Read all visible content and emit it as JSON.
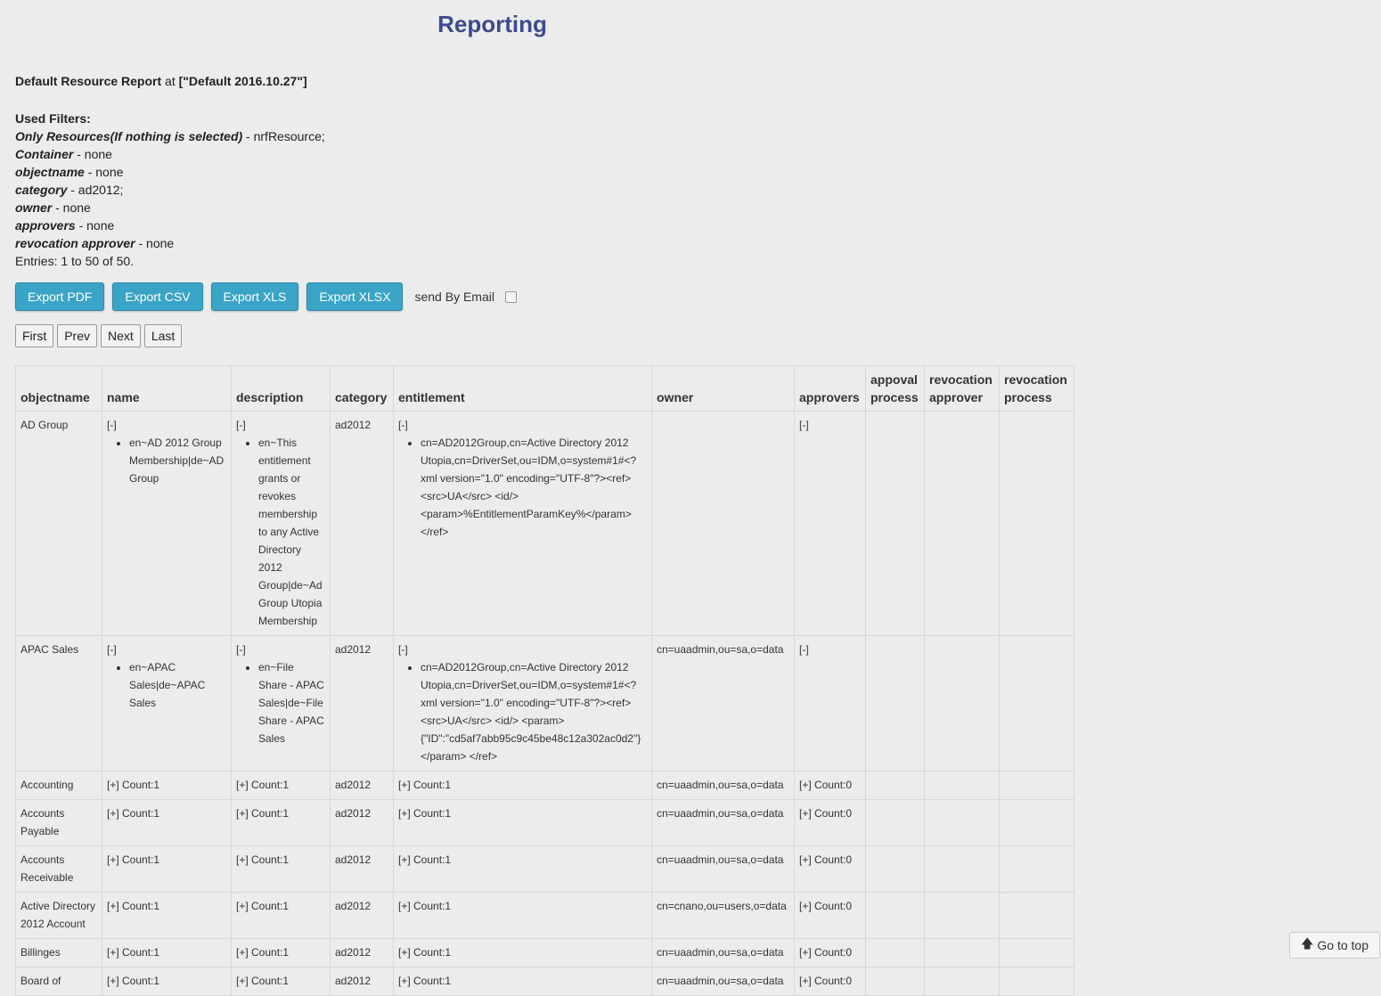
{
  "title": "Reporting",
  "report": {
    "name": "Default Resource Report",
    "at_word": "at",
    "version": "[\"Default 2016.10.27\"]"
  },
  "filters": {
    "heading": "Used Filters:",
    "items": [
      {
        "name": "Only Resources(If nothing is selected)",
        "value": " - nrfResource;"
      },
      {
        "name": "Container",
        "value": " - none"
      },
      {
        "name": "objectname",
        "value": " - none"
      },
      {
        "name": "category",
        "value": " - ad2012;"
      },
      {
        "name": "owner",
        "value": " - none"
      },
      {
        "name": "approvers",
        "value": " - none"
      },
      {
        "name": "revocation approver",
        "value": " - none"
      }
    ],
    "entries": "Entries: 1 to 50 of 50."
  },
  "toolbar": {
    "export_pdf": "Export PDF",
    "export_csv": "Export CSV",
    "export_xls": "Export XLS",
    "export_xlsx": "Export XLSX",
    "send_email": "send By Email"
  },
  "pager": {
    "first": "First",
    "prev": "Prev",
    "next": "Next",
    "last": "Last"
  },
  "table": {
    "headers": [
      "objectname",
      "name",
      "description",
      "category",
      "entitlement",
      "owner",
      "approvers",
      "appoval process",
      "revocation approver",
      "revocation process"
    ],
    "rows": [
      {
        "objectname": "AD Group",
        "name_toggle": "[-]",
        "name_item": "en~AD 2012 Group Membership|de~AD Group",
        "desc_toggle": "[-]",
        "desc_item": "en~This entitlement grants or revokes membership to any Active Directory 2012 Group|de~Ad Group Utopia Membership",
        "category": "ad2012",
        "ent_toggle": "[-]",
        "ent_item": "cn=AD2012Group,cn=Active Directory 2012 Utopia,cn=DriverSet,ou=IDM,o=system#1#<?xml version=\"1.0\" encoding=\"UTF-8\"?><ref><src>UA</src> <id/> <param>%EntitlementParamKey%</param></ref>",
        "owner": "",
        "approvers": "[-]"
      },
      {
        "objectname": "APAC Sales",
        "name_toggle": "[-]",
        "name_item": "en~APAC Sales|de~APAC Sales",
        "desc_toggle": "[-]",
        "desc_item": "en~File Share - APAC Sales|de~File Share - APAC Sales",
        "category": "ad2012",
        "ent_toggle": "[-]",
        "ent_item": "cn=AD2012Group,cn=Active Directory 2012 Utopia,cn=DriverSet,ou=IDM,o=system#1#<?xml version=\"1.0\" encoding=\"UTF-8\"?><ref><src>UA</src> <id/> <param>{\"ID\":\"cd5af7abb95c9c45be48c12a302ac0d2\"}</param> </ref>",
        "owner": "cn=uaadmin,ou=sa,o=data",
        "approvers": "[-]"
      }
    ],
    "simple_rows": [
      {
        "objectname": "Accounting",
        "name": "[+] Count:1",
        "description": "[+] Count:1",
        "category": "ad2012",
        "entitlement": "[+] Count:1",
        "owner": "cn=uaadmin,ou=sa,o=data",
        "approvers": "[+] Count:0"
      },
      {
        "objectname": "Accounts Payable",
        "name": "[+] Count:1",
        "description": "[+] Count:1",
        "category": "ad2012",
        "entitlement": "[+] Count:1",
        "owner": "cn=uaadmin,ou=sa,o=data",
        "approvers": "[+] Count:0"
      },
      {
        "objectname": "Accounts Receivable",
        "name": "[+] Count:1",
        "description": "[+] Count:1",
        "category": "ad2012",
        "entitlement": "[+] Count:1",
        "owner": "cn=uaadmin,ou=sa,o=data",
        "approvers": "[+] Count:0"
      },
      {
        "objectname": "Active Directory 2012 Account",
        "name": "[+] Count:1",
        "description": "[+] Count:1",
        "category": "ad2012",
        "entitlement": "[+] Count:1",
        "owner": "cn=cnano,ou=users,o=data",
        "approvers": "[+] Count:0"
      },
      {
        "objectname": "Billinges",
        "name": "[+] Count:1",
        "description": "[+] Count:1",
        "category": "ad2012",
        "entitlement": "[+] Count:1",
        "owner": "cn=uaadmin,ou=sa,o=data",
        "approvers": "[+] Count:0"
      },
      {
        "objectname": "Board of",
        "name": "[+] Count:1",
        "description": "[+] Count:1",
        "category": "ad2012",
        "entitlement": "[+] Count:1",
        "owner": "cn=uaadmin,ou=sa,o=data",
        "approvers": "[+] Count:0"
      }
    ]
  },
  "go_top": "Go to top",
  "colors": {
    "title": "#3d4a8e",
    "button": "#3aa4c6",
    "background": "#ececec"
  },
  "icons": {
    "go_top": "arrow-up-icon"
  }
}
